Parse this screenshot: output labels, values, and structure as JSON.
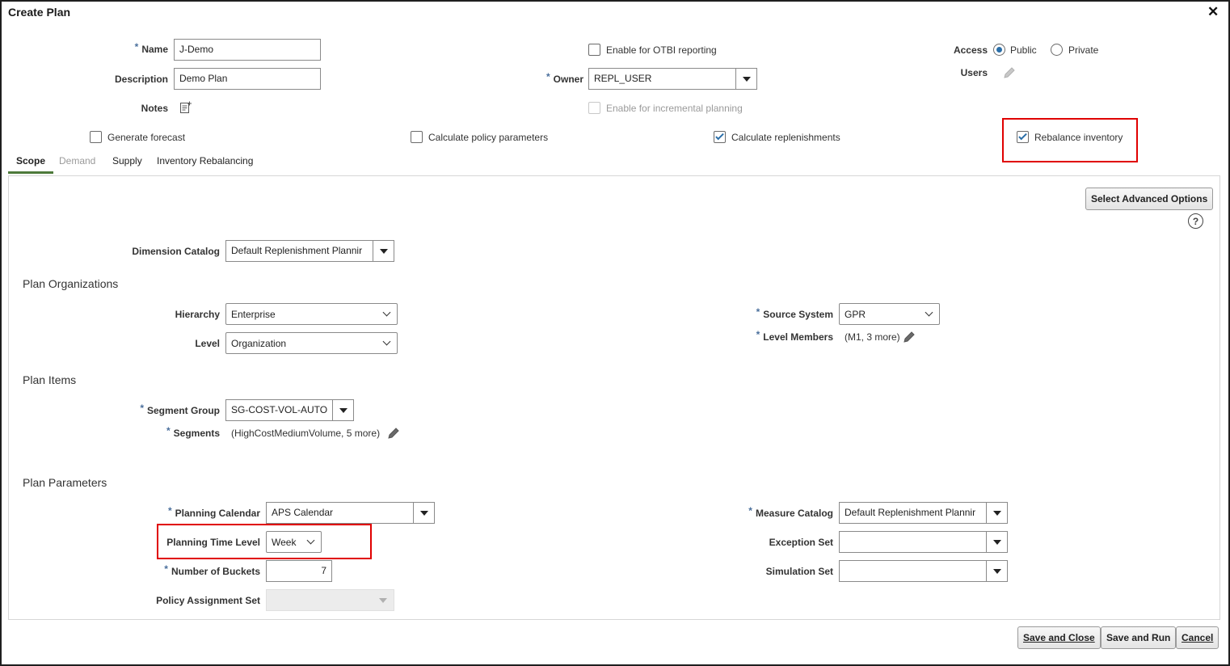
{
  "dialog": {
    "title": "Create Plan",
    "close_glyph": "✕"
  },
  "header": {
    "name_label": "Name",
    "name_value": "J-Demo",
    "description_label": "Description",
    "description_value": "Demo Plan",
    "notes_label": "Notes",
    "otbi_label": "Enable for OTBI reporting",
    "owner_label": "Owner",
    "owner_value": "REPL_USER",
    "incremental_label": "Enable for incremental planning",
    "access_label": "Access",
    "public_label": "Public",
    "private_label": "Private",
    "users_label": "Users"
  },
  "options": {
    "generate_forecast": "Generate forecast",
    "calc_policy": "Calculate policy parameters",
    "calc_replenishments": "Calculate replenishments",
    "rebalance_inventory": "Rebalance inventory"
  },
  "tabs": [
    "Scope",
    "Demand",
    "Supply",
    "Inventory Rebalancing"
  ],
  "scope": {
    "advanced_button": "Select Advanced Options",
    "dimension_catalog_label": "Dimension Catalog",
    "dimension_catalog_value": "Default Replenishment Plannir",
    "plan_orgs_title": "Plan Organizations",
    "hierarchy_label": "Hierarchy",
    "hierarchy_value": "Enterprise",
    "level_label": "Level",
    "level_value": "Organization",
    "source_system_label": "Source System",
    "source_system_value": "GPR",
    "level_members_label": "Level Members",
    "level_members_value": "(M1, 3 more)",
    "plan_items_title": "Plan Items",
    "segment_group_label": "Segment Group",
    "segment_group_value": "SG-COST-VOL-AUTO",
    "segments_label": "Segments",
    "segments_value": "(HighCostMediumVolume, 5 more)",
    "plan_params_title": "Plan Parameters",
    "planning_calendar_label": "Planning Calendar",
    "planning_calendar_value": "APS Calendar",
    "planning_time_level_label": "Planning Time Level",
    "planning_time_level_value": "Week",
    "number_of_buckets_label": "Number of Buckets",
    "number_of_buckets_value": "7",
    "policy_assignment_label": "Policy Assignment Set",
    "measure_catalog_label": "Measure Catalog",
    "measure_catalog_value": "Default Replenishment Plannir",
    "exception_set_label": "Exception Set",
    "simulation_set_label": "Simulation Set"
  },
  "footer": {
    "save_close": "Save and Close",
    "save_run": "Save and Run",
    "cancel": "Cancel"
  },
  "colors": {
    "highlight": "#e00000",
    "check_blue": "#2a6ea8",
    "active_tab": "#4d7a3a"
  }
}
